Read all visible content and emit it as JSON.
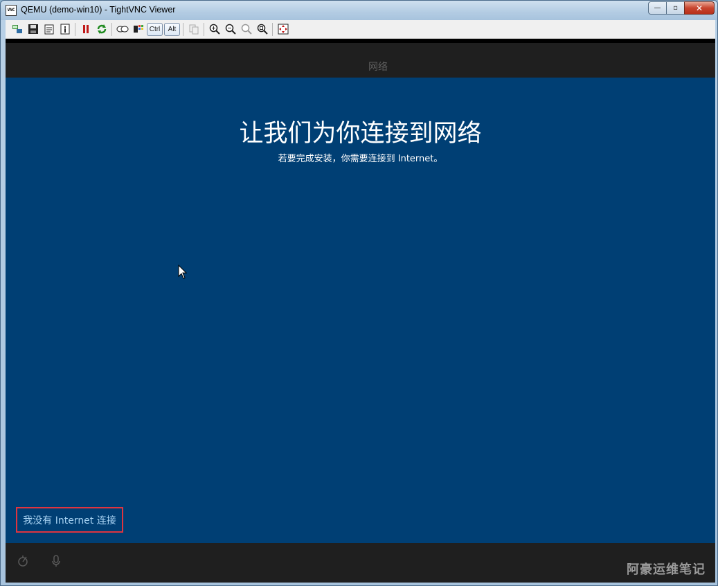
{
  "window": {
    "title": "QEMU (demo-win10) - TightVNC Viewer",
    "app_icon_text": "VNC",
    "minimize_symbol": "—",
    "maximize_symbol": "▫",
    "close_symbol": "✕"
  },
  "toolbar": {
    "ctrl_label": "Ctrl",
    "alt_label": "Alt",
    "icons": [
      "new-connection-icon",
      "save-icon",
      "options-icon",
      "info-icon",
      "pause-icon",
      "refresh-icon",
      "ctrl-alt-del-icon",
      "ctrl-esc-icon",
      "copy-icon",
      "zoom-in-icon",
      "zoom-out-icon",
      "zoom-100-icon",
      "zoom-fit-icon",
      "fullscreen-icon"
    ]
  },
  "oobe": {
    "header_label": "网络",
    "title": "让我们为你连接到网络",
    "subtitle": "若要完成安装，你需要连接到 Internet。",
    "no_internet_link": "我没有 Internet 连接",
    "watermark": "阿豪运维笔记"
  },
  "colors": {
    "oobe_blue": "#003f74",
    "header_footer": "#1f1f1f",
    "link": "#a7d2f2",
    "highlight_box": "#e0343f"
  }
}
